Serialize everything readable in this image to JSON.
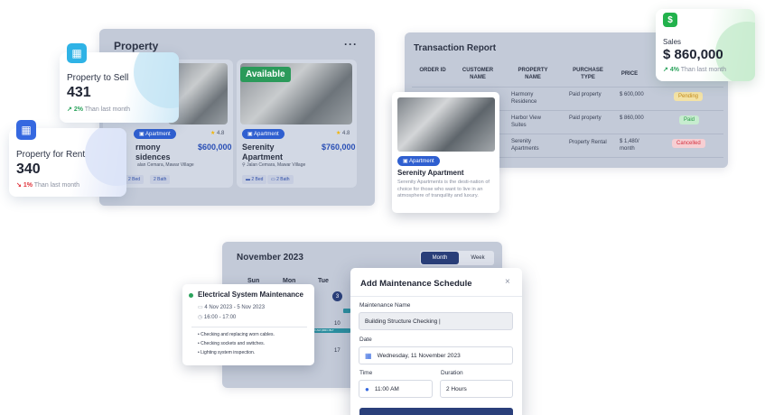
{
  "property": {
    "title": "Property",
    "menu_icon": "more-dots-icon",
    "available_badge": "Available",
    "cards": [
      {
        "tag": "Apartment",
        "rating": "4.8",
        "name": "Harmony Residences",
        "name_visible": "rmony sidences",
        "price": "$600,000",
        "location": "Jalan Cemara, Mawar Village",
        "location_visible": "alan Cemara, Mawar Village",
        "beds": "2 Bed",
        "baths": "2 Bath"
      },
      {
        "tag": "Apartment",
        "rating": "4.8",
        "name": "Serenity Apartment",
        "price": "$760,000",
        "location": "Jalan Cemara, Mawar Village",
        "beds": "2 Bed",
        "baths": "2 Bath"
      }
    ]
  },
  "stats": {
    "sell": {
      "label": "Property to Sell",
      "value": "431",
      "change": "2%",
      "suffix": "Than last month",
      "icon": "building-icon",
      "accent": "#2fb3e6"
    },
    "rent": {
      "label": "Property for Rent",
      "value": "340",
      "change": "1%",
      "suffix": "Than last month",
      "icon": "building-icon",
      "accent": "#3568e0"
    },
    "sales": {
      "label": "Sales",
      "value": "$ 860,000",
      "change": "4%",
      "suffix": "Than last month",
      "icon": "dollar-icon",
      "accent": "#22b24c"
    }
  },
  "transactions": {
    "title": "Transaction Report",
    "headers": [
      "ORDER ID",
      "CUSTOMER NAME",
      "PROPERTY NAME",
      "PURCHASE TYPE",
      "PRICE"
    ],
    "rows": [
      {
        "property": "Harmony Residence",
        "type": "Paid property",
        "price": "$ 600,000",
        "status": "Pending"
      },
      {
        "property": "Harbor View Suites",
        "type": "Paid property",
        "price": "$ 860,000",
        "status": "Paid"
      },
      {
        "property": "Serenity Apartments",
        "type": "Property Rental",
        "price": "$ 1,480/ month",
        "status": "Cancelled"
      }
    ]
  },
  "serenity": {
    "tag": "Apartment",
    "name": "Serenity Apartment",
    "description": "Serenity Apartments is the desti-nation of choice for those who want to live in an atmosphere of tranquility and luxury."
  },
  "calendar": {
    "title": "November 2023",
    "view_month": "Month",
    "view_week": "Week",
    "days": [
      "Sun",
      "Mon",
      "Tue"
    ],
    "dates": [
      "3",
      "10",
      "17"
    ],
    "event_bar_text": "0 AM (MRC BLT"
  },
  "event": {
    "title": "Electrical System Maintenance",
    "date_range": "4 Nov 2023 - 5 Nov 2023",
    "time_range": "16:00 - 17:00",
    "items": [
      "Checking and replacing worn cables.",
      "Checking sockets and switches.",
      "Lighting system inspection."
    ]
  },
  "modal": {
    "title": "Add Maintenance Schedule",
    "close": "×",
    "name_label": "Maintenance Name",
    "name_value": "Building Structure Checking |",
    "date_label": "Date",
    "date_value": "Wednesday, 11 November 2023",
    "time_label": "Time",
    "time_value": "11:00 AM",
    "duration_label": "Duration",
    "duration_value": "2 Hours"
  }
}
